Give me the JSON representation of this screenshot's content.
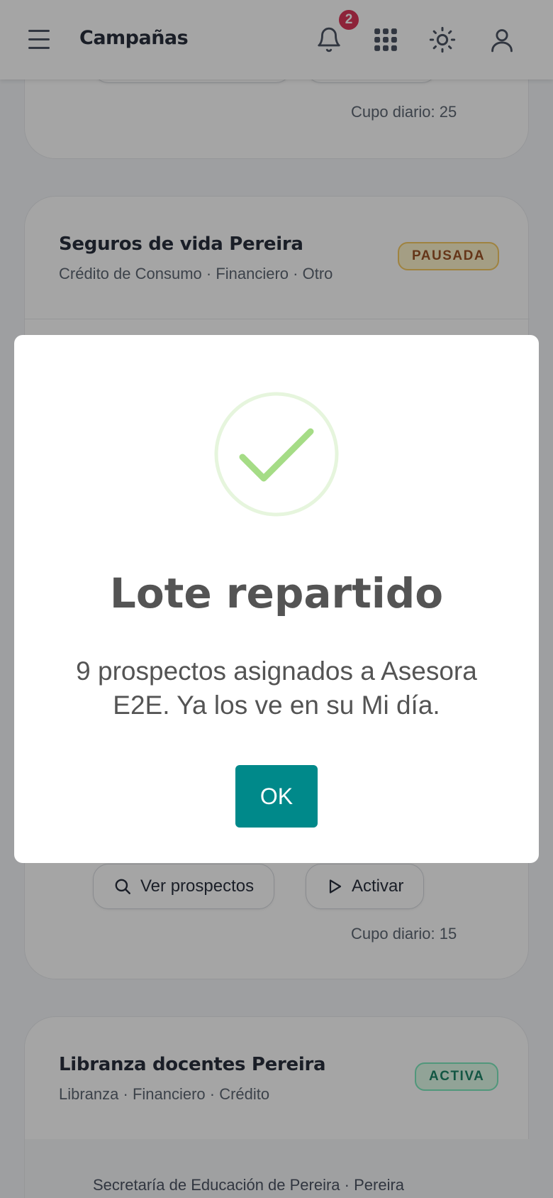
{
  "header": {
    "title": "Campañas",
    "notification_count": "2"
  },
  "campaigns": [
    {
      "quota": "Cupo diario: 25"
    },
    {
      "title": "Seguros de vida Pereira",
      "subtitle": "Crédito de Consumo · Financiero · Otro",
      "status": "PAUSADA",
      "view_button": "Ver prospectos",
      "action_button": "Activar",
      "quota": "Cupo diario: 15"
    },
    {
      "title": "Libranza docentes Pereira",
      "subtitle": "Libranza · Financiero · Crédito",
      "status": "ACTIVA",
      "entity": "Secretaría de Educación de Pereira · Pereira"
    }
  ],
  "modal": {
    "title": "Lote repartido",
    "message": "9 prospectos asignados a Asesora E2E. Ya los ve en su Mi día.",
    "ok_label": "OK",
    "icon": "success-check-icon"
  },
  "colors": {
    "accent": "#00898a",
    "badge_red": "#d61f45",
    "paused": "#92400e",
    "active": "#047857",
    "success_check": "#a5dc86"
  }
}
